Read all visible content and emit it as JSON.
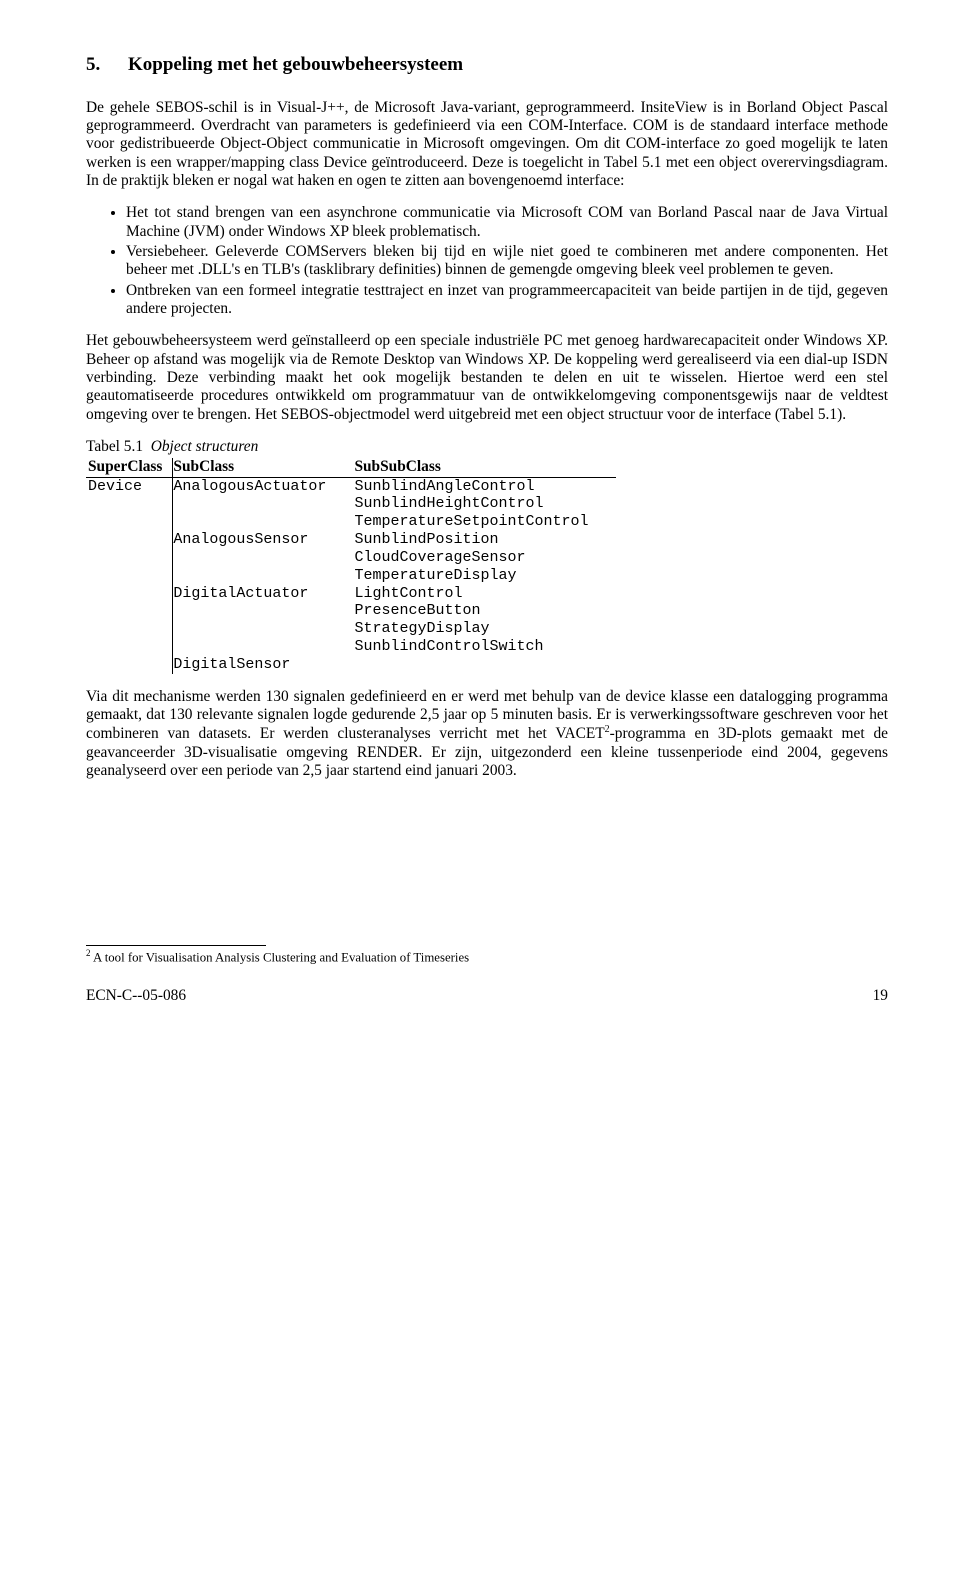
{
  "heading": {
    "num": "5.",
    "title": "Koppeling met het gebouwbeheersysteem"
  },
  "para1a": "De gehele SEBOS-schil is in Visual-J++, de Microsoft Java-variant, geprogrammeerd. InsiteView is in Borland Object Pascal geprogrammeerd. Overdracht van parameters is gedefinieerd via een COM-Interface. COM is de standaard interface methode voor gedistribueerde Object-Object communicatie in Microsoft omgevingen. Om dit COM-interface zo goed mogelijk te laten werken is een wrapper/mapping class Device geïntroduceerd. Deze is toegelicht in Tabel 5.1 met een object overervingsdiagram. In de praktijk bleken er nogal wat haken en ogen te zitten aan bovengenoemd interface:",
  "bullets": {
    "b1": "Het tot stand brengen van een asynchrone communicatie via Microsoft COM van Borland Pascal naar de Java Virtual Machine (JVM) onder Windows XP bleek problematisch.",
    "b2": "Versiebeheer. Geleverde COMServers bleken bij tijd en wijle niet goed te combineren met andere componenten. Het beheer met .DLL's en TLB's (tasklibrary definities) binnen de gemengde omgeving bleek veel problemen te geven.",
    "b3": "Ontbreken van een formeel integratie testtraject en inzet van programmeercapaciteit van beide partijen in de tijd, gegeven andere projecten."
  },
  "para2": "Het gebouwbeheersysteem werd geïnstalleerd op een speciale industriële PC met genoeg hardwarecapaciteit onder Windows XP. Beheer op afstand was mogelijk via de Remote Desktop van Windows XP. De koppeling werd gerealiseerd via een dial-up ISDN verbinding. Deze verbinding maakt het ook mogelijk bestanden te delen en uit te wisselen. Hiertoe werd een stel geautomatiseerde procedures ontwikkeld om programmatuur van de ontwikkelomgeving componentsgewijs naar de veldtest omgeving over te brengen. Het SEBOS-objectmodel werd uitgebreid met een object structuur voor de interface (Tabel 5.1).",
  "tablecaption": {
    "label": "Tabel 5.1",
    "title": "Object structuren"
  },
  "table": {
    "head": {
      "c1": "SuperClass",
      "c2": "SubClass",
      "c3": "SubSubClass"
    },
    "super": "Device",
    "sub1": "AnalogousActuator",
    "sub1_items": {
      "a": "SunblindAngleControl",
      "b": "SunblindHeightControl",
      "c": "TemperatureSetpointControl"
    },
    "sub2": "AnalogousSensor",
    "sub2_items": {
      "a": "SunblindPosition",
      "b": "CloudCoverageSensor",
      "c": "TemperatureDisplay"
    },
    "sub3": "DigitalActuator",
    "sub3_items": {
      "a": "LightControl",
      "b": "PresenceButton",
      "c": "StrategyDisplay",
      "d": "SunblindControlSwitch"
    },
    "sub4": "DigitalSensor"
  },
  "para3a": "Via dit mechanisme werden 130 signalen gedefinieerd en er werd met  behulp van de device klasse een datalogging programma gemaakt, dat 130 relevante signalen logde  gedurende 2,5 jaar op 5 minuten basis. Er is verwerkingssoftware geschreven voor het combineren van datasets. Er werden clusteranalyses verricht met het VACET",
  "para3b": "-programma en 3D-plots gemaakt met de geavanceerder 3D-visualisatie omgeving RENDER. Er zijn, uitgezonderd een kleine tussenperiode eind 2004, gegevens geanalyseerd over een periode van 2,5 jaar startend eind januari 2003.",
  "footnote": {
    "num": "2",
    "text": " A tool for Visualisation Analysis Clustering and Evaluation of Timeseries"
  },
  "footer": {
    "left": "ECN-C--05-086",
    "right": "19"
  }
}
